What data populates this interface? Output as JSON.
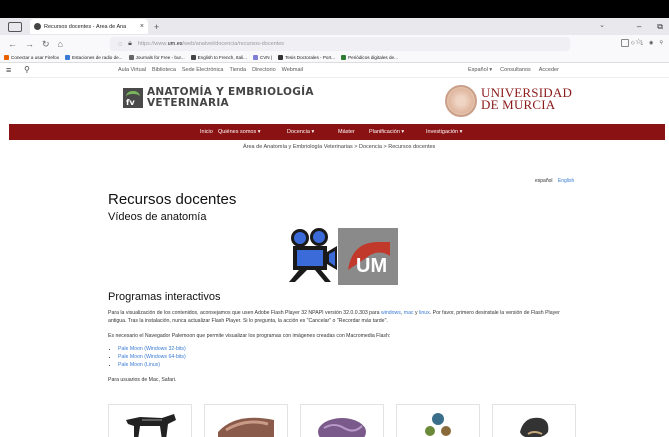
{
  "browser": {
    "tab_title": "Recursos docentes - Área de Ana",
    "tab_close": "×",
    "new_tab": "+",
    "url_prefix": "https://www.",
    "url_host": "um.es",
    "url_path": "/web/anatvet/docencia/recursos-docentes",
    "bookmarks": [
      {
        "label": "Conectar a usar Firefox",
        "color": "#e66000"
      },
      {
        "label": "Estaciones de radio de...",
        "color": "#3a7bd5"
      },
      {
        "label": "Journals for Free - bur...",
        "color": "#666666"
      },
      {
        "label": "English to French, Itali...",
        "color": "#444444"
      },
      {
        "label": "CVN |",
        "color": "#7f7fd5"
      },
      {
        "label": "Tesis Doctorales - Port...",
        "color": "#333333"
      },
      {
        "label": "Periódicos digitales de...",
        "color": "#2e7d32"
      }
    ]
  },
  "site": {
    "top_links": [
      "Aula Virtual",
      "Biblioteca",
      "Sede Electrónica",
      "Tienda",
      "Directorio",
      "Webmail"
    ],
    "account": [
      "Español ▾",
      "Consultanos",
      "Acceder"
    ],
    "dept_logo_text": "fv",
    "dept_name_line1": "ANATOMÍA Y EMBRIOLOGÍA",
    "dept_name_line2": "VETERINARIA",
    "university_line1": "UNIVERSIDAD",
    "university_line2": "DE MURCIA",
    "nav": [
      "Inicio",
      "Quiénes somos ▾",
      "Docencia ▾",
      "Máster",
      "Planificación ▾",
      "Investigación ▾"
    ],
    "breadcrumb": "Área de Anatomía y Embriología Veterinarias  >  Docencia  >  Recursos docentes"
  },
  "content": {
    "lang_es": "español",
    "lang_en": "English",
    "title": "Recursos docentes",
    "videos_heading": "Vídeos de anatomía",
    "video_logo_text": "UM",
    "programs_heading": "Programas interactivos",
    "p1_a": "Para la visualización de los contenidos, aconsejamos que usen Adobe Flash Player 32 NPAPI versión 32.0.0.303 para ",
    "p1_win": "windows",
    "p1_sep1": ", ",
    "p1_mac": "mac",
    "p1_sep2": " y ",
    "p1_linux": "linux",
    "p1_b": ". Por favor, primero desinstale la versión de Flash Player antigua. Tras la instalación, nunca actualizar Flash Player. Si lo pregunta, la acción es \"Cancelar\" o \"Recordar más tarde\".",
    "p2": "Es necesario el Navegador Palemoon que permite visualizar los programas con imágenes creadas con Macromedia Flash:",
    "downloads": [
      "Pale Moon (Windows 32-bits)",
      "Pale Moon (Windows 64-bits)",
      "Pale Moon (Linux)"
    ],
    "p3": "Para usuarios de Mac, Safari."
  }
}
